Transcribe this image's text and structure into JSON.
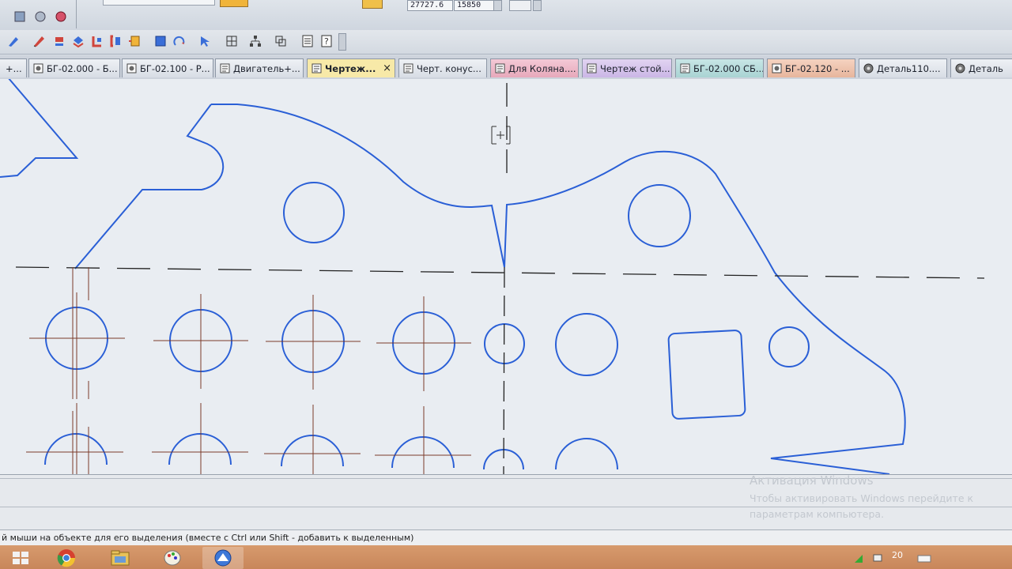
{
  "toolbar": {
    "field_x_value": "27727.6",
    "field_y_value": "15850"
  },
  "tabs": [
    {
      "label": "+...",
      "style": "plain"
    },
    {
      "label": "БГ-02.000 - Б...",
      "style": "plain"
    },
    {
      "label": "БГ-02.100 - Р...",
      "style": "plain"
    },
    {
      "label": "Двигатель+...",
      "style": "plain"
    },
    {
      "label": "Чертеж...",
      "style": "active",
      "close": "×"
    },
    {
      "label": "Черт. конус...",
      "style": "plain"
    },
    {
      "label": "Для Коляна....",
      "style": "pink"
    },
    {
      "label": "Чертеж стой...",
      "style": "violet"
    },
    {
      "label": "БГ-02.000 СБ...",
      "style": "teal"
    },
    {
      "label": "БГ-02.120 - ...",
      "style": "salmon"
    },
    {
      "label": "Деталь110....",
      "style": "plain"
    },
    {
      "label": "Деталь",
      "style": "plain"
    }
  ],
  "watermark": {
    "title": "Активация Windows",
    "line1": "Чтобы активировать Windows перейдите к",
    "line2": "параметрам компьютера."
  },
  "status": {
    "hint": "й мыши на объекте для его выделения (вместе с Ctrl или Shift - добавить к выделенным)"
  },
  "tray": {
    "clock": "20"
  },
  "colors": {
    "drawing_line": "#2a5fd6",
    "axis_line": "#7a3a2a",
    "canvas_bg": "#e9edf2",
    "taskbar": "#c8865a"
  },
  "icons": {
    "taskbar": [
      "start-icon",
      "chrome-icon",
      "explorer-icon",
      "paint-icon",
      "kompas-icon"
    ]
  }
}
